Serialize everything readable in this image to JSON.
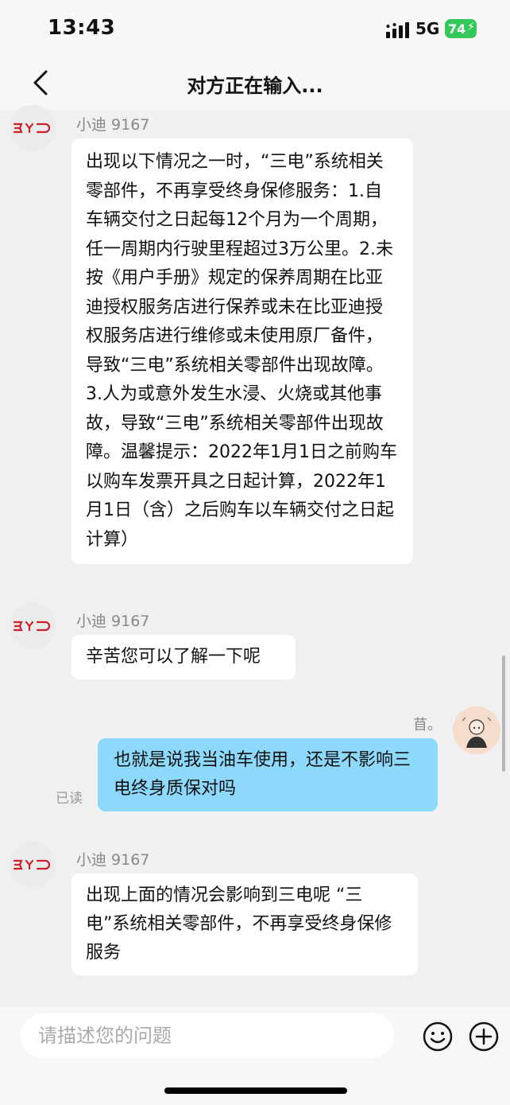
{
  "status_bar": {
    "time": "13:43",
    "network": "5G",
    "battery": "74"
  },
  "header": {
    "title": "对方正在输入..."
  },
  "messages": [
    {
      "sender": "小迪 9167",
      "text": "出现以下情况之一时，“三电”系统相关零部件，不再享受终身保修服务：1.自车辆交付之日起每12个月为一个周期，任一周期内行驶里程超过3万公里。2.未按《用户手册》规定的保养周期在比亚迪授权服务店进行保养或未在比亚迪授权服务店进行维修或未使用原厂备件，导致“三电”系统相关零部件出现故障。3.人为或意外发生水浸、火烧或其他事故，导致“三电”系统相关零部件出现故障。温馨提示：2022年1月1日之前购车以购车发票开具之日起计算，2022年1月1日（含）之后购车以车辆交付之日起计算）"
    },
    {
      "sender": "小迪 9167",
      "text": "辛苦您可以了解一下呢"
    },
    {
      "sender": "苜。",
      "text": "也就是说我当油车使用，还是不影响三电终身质保对吗",
      "status": "已读"
    },
    {
      "sender": "小迪 9167",
      "text": "出现上面的情况会影响到三电呢 “三电”系统相关零部件，不再享受终身保修服务"
    }
  ],
  "input": {
    "placeholder": "请描述您的问题"
  },
  "icons": {
    "back": "back-chevron-icon",
    "emoji": "emoji-icon",
    "plus": "plus-icon",
    "brand": "byd-logo"
  },
  "colors": {
    "brand_red": "#d0202a",
    "outgoing_bubble": "#8dd9fb",
    "battery_green": "#34c759"
  }
}
